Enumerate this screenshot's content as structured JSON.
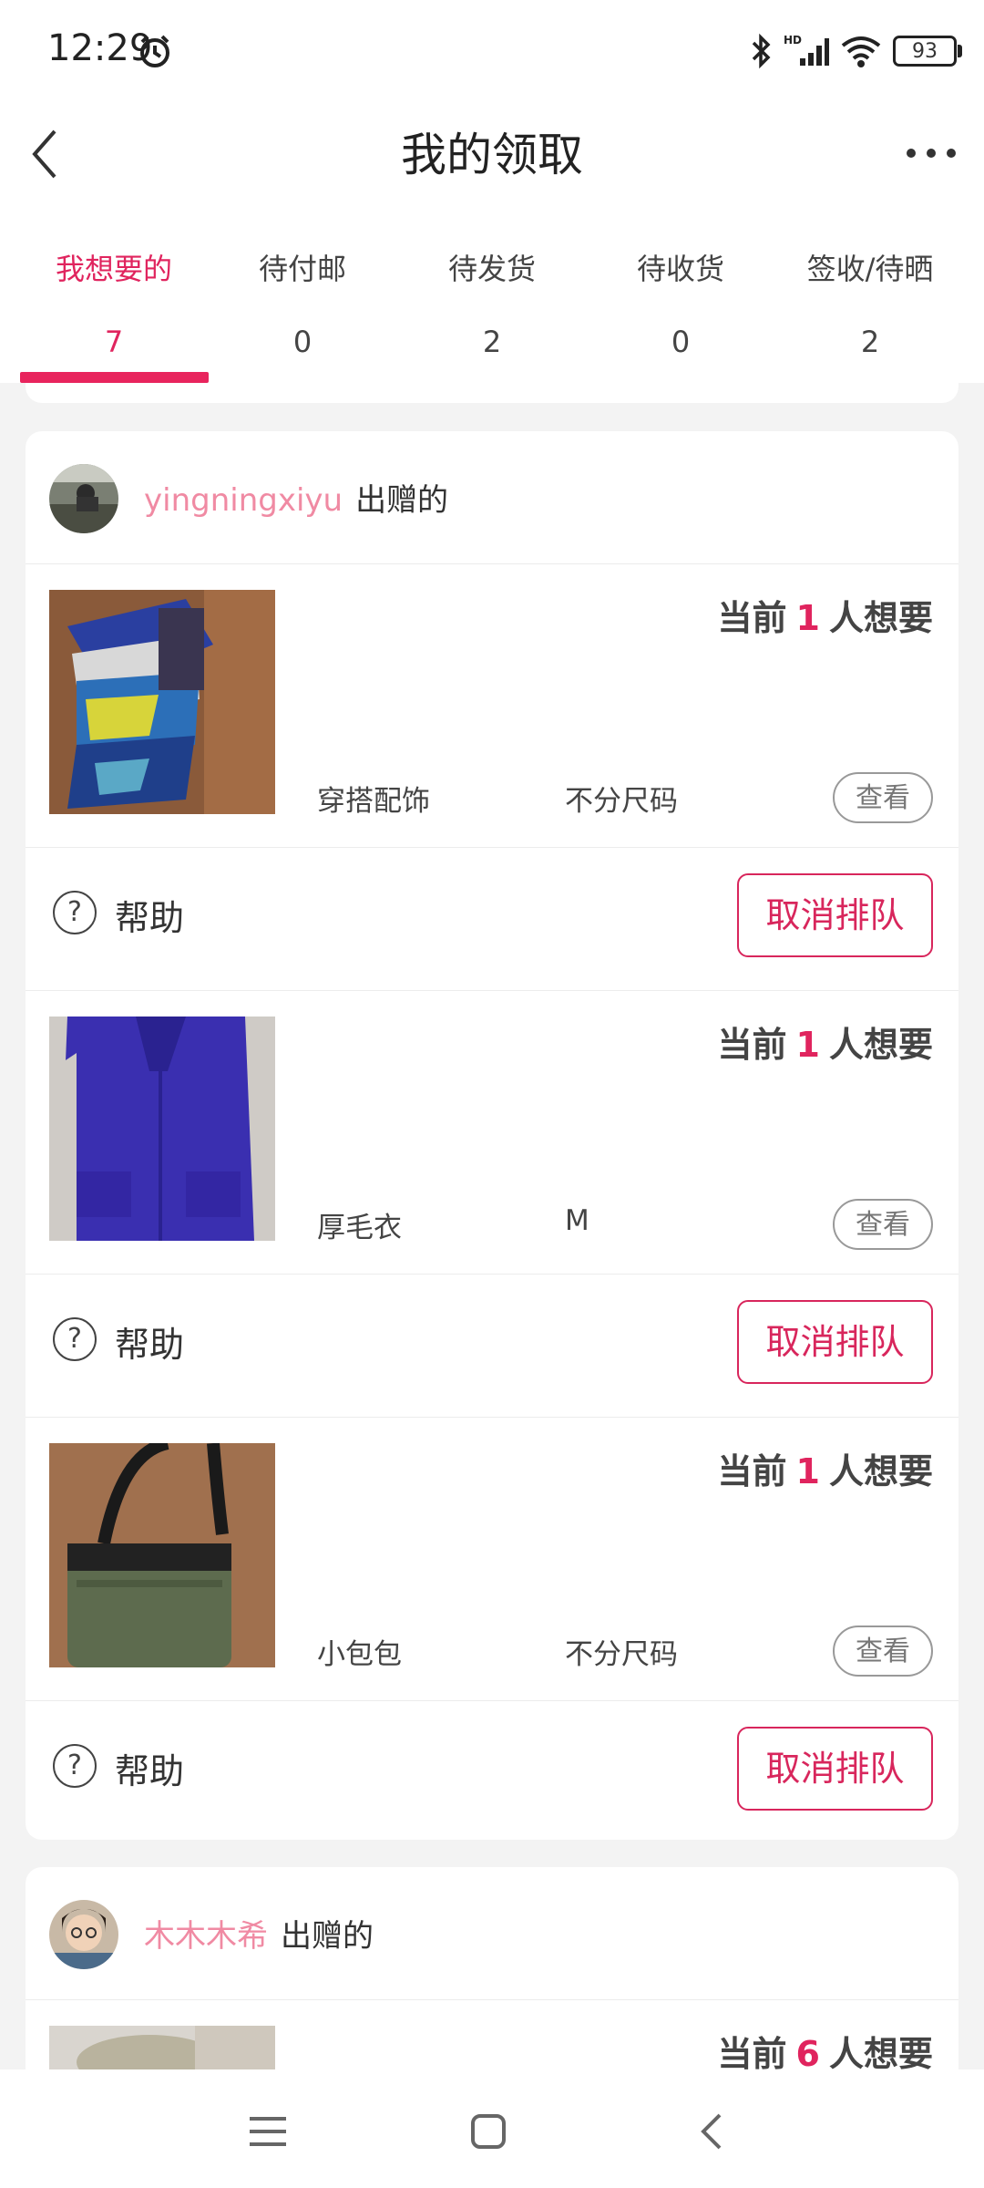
{
  "status": {
    "time": "12:29",
    "battery": "93"
  },
  "header": {
    "title": "我的领取"
  },
  "tabs": [
    {
      "label": "我想要的",
      "count": "7"
    },
    {
      "label": "待付邮",
      "count": "0"
    },
    {
      "label": "待发货",
      "count": "2"
    },
    {
      "label": "待收货",
      "count": "0"
    },
    {
      "label": "签收/待晒",
      "count": "2"
    }
  ],
  "colors": {
    "accent": "#e0245e",
    "giver_name": "#f08aa3"
  },
  "cards": [
    {
      "giver": {
        "name": "yingningxiyu",
        "suffix": "出赠的"
      },
      "items": [
        {
          "want_prefix": "当前",
          "want_count": "1",
          "want_suffix": "人想要",
          "category": "穿搭配饰",
          "size": "不分尺码",
          "view": "查看",
          "help": "帮助",
          "cancel": "取消排队"
        },
        {
          "want_prefix": "当前",
          "want_count": "1",
          "want_suffix": "人想要",
          "category": "厚毛衣",
          "size": "M",
          "view": "查看",
          "help": "帮助",
          "cancel": "取消排队"
        },
        {
          "want_prefix": "当前",
          "want_count": "1",
          "want_suffix": "人想要",
          "category": "小包包",
          "size": "不分尺码",
          "view": "查看",
          "help": "帮助",
          "cancel": "取消排队"
        }
      ]
    },
    {
      "giver": {
        "name": "木木木希",
        "suffix": "出赠的"
      },
      "items": [
        {
          "want_prefix": "当前",
          "want_count": "6",
          "want_suffix": "人想要"
        }
      ]
    }
  ],
  "navbar": {
    "icons": [
      "menu-icon",
      "home-square-icon",
      "back-icon"
    ]
  }
}
